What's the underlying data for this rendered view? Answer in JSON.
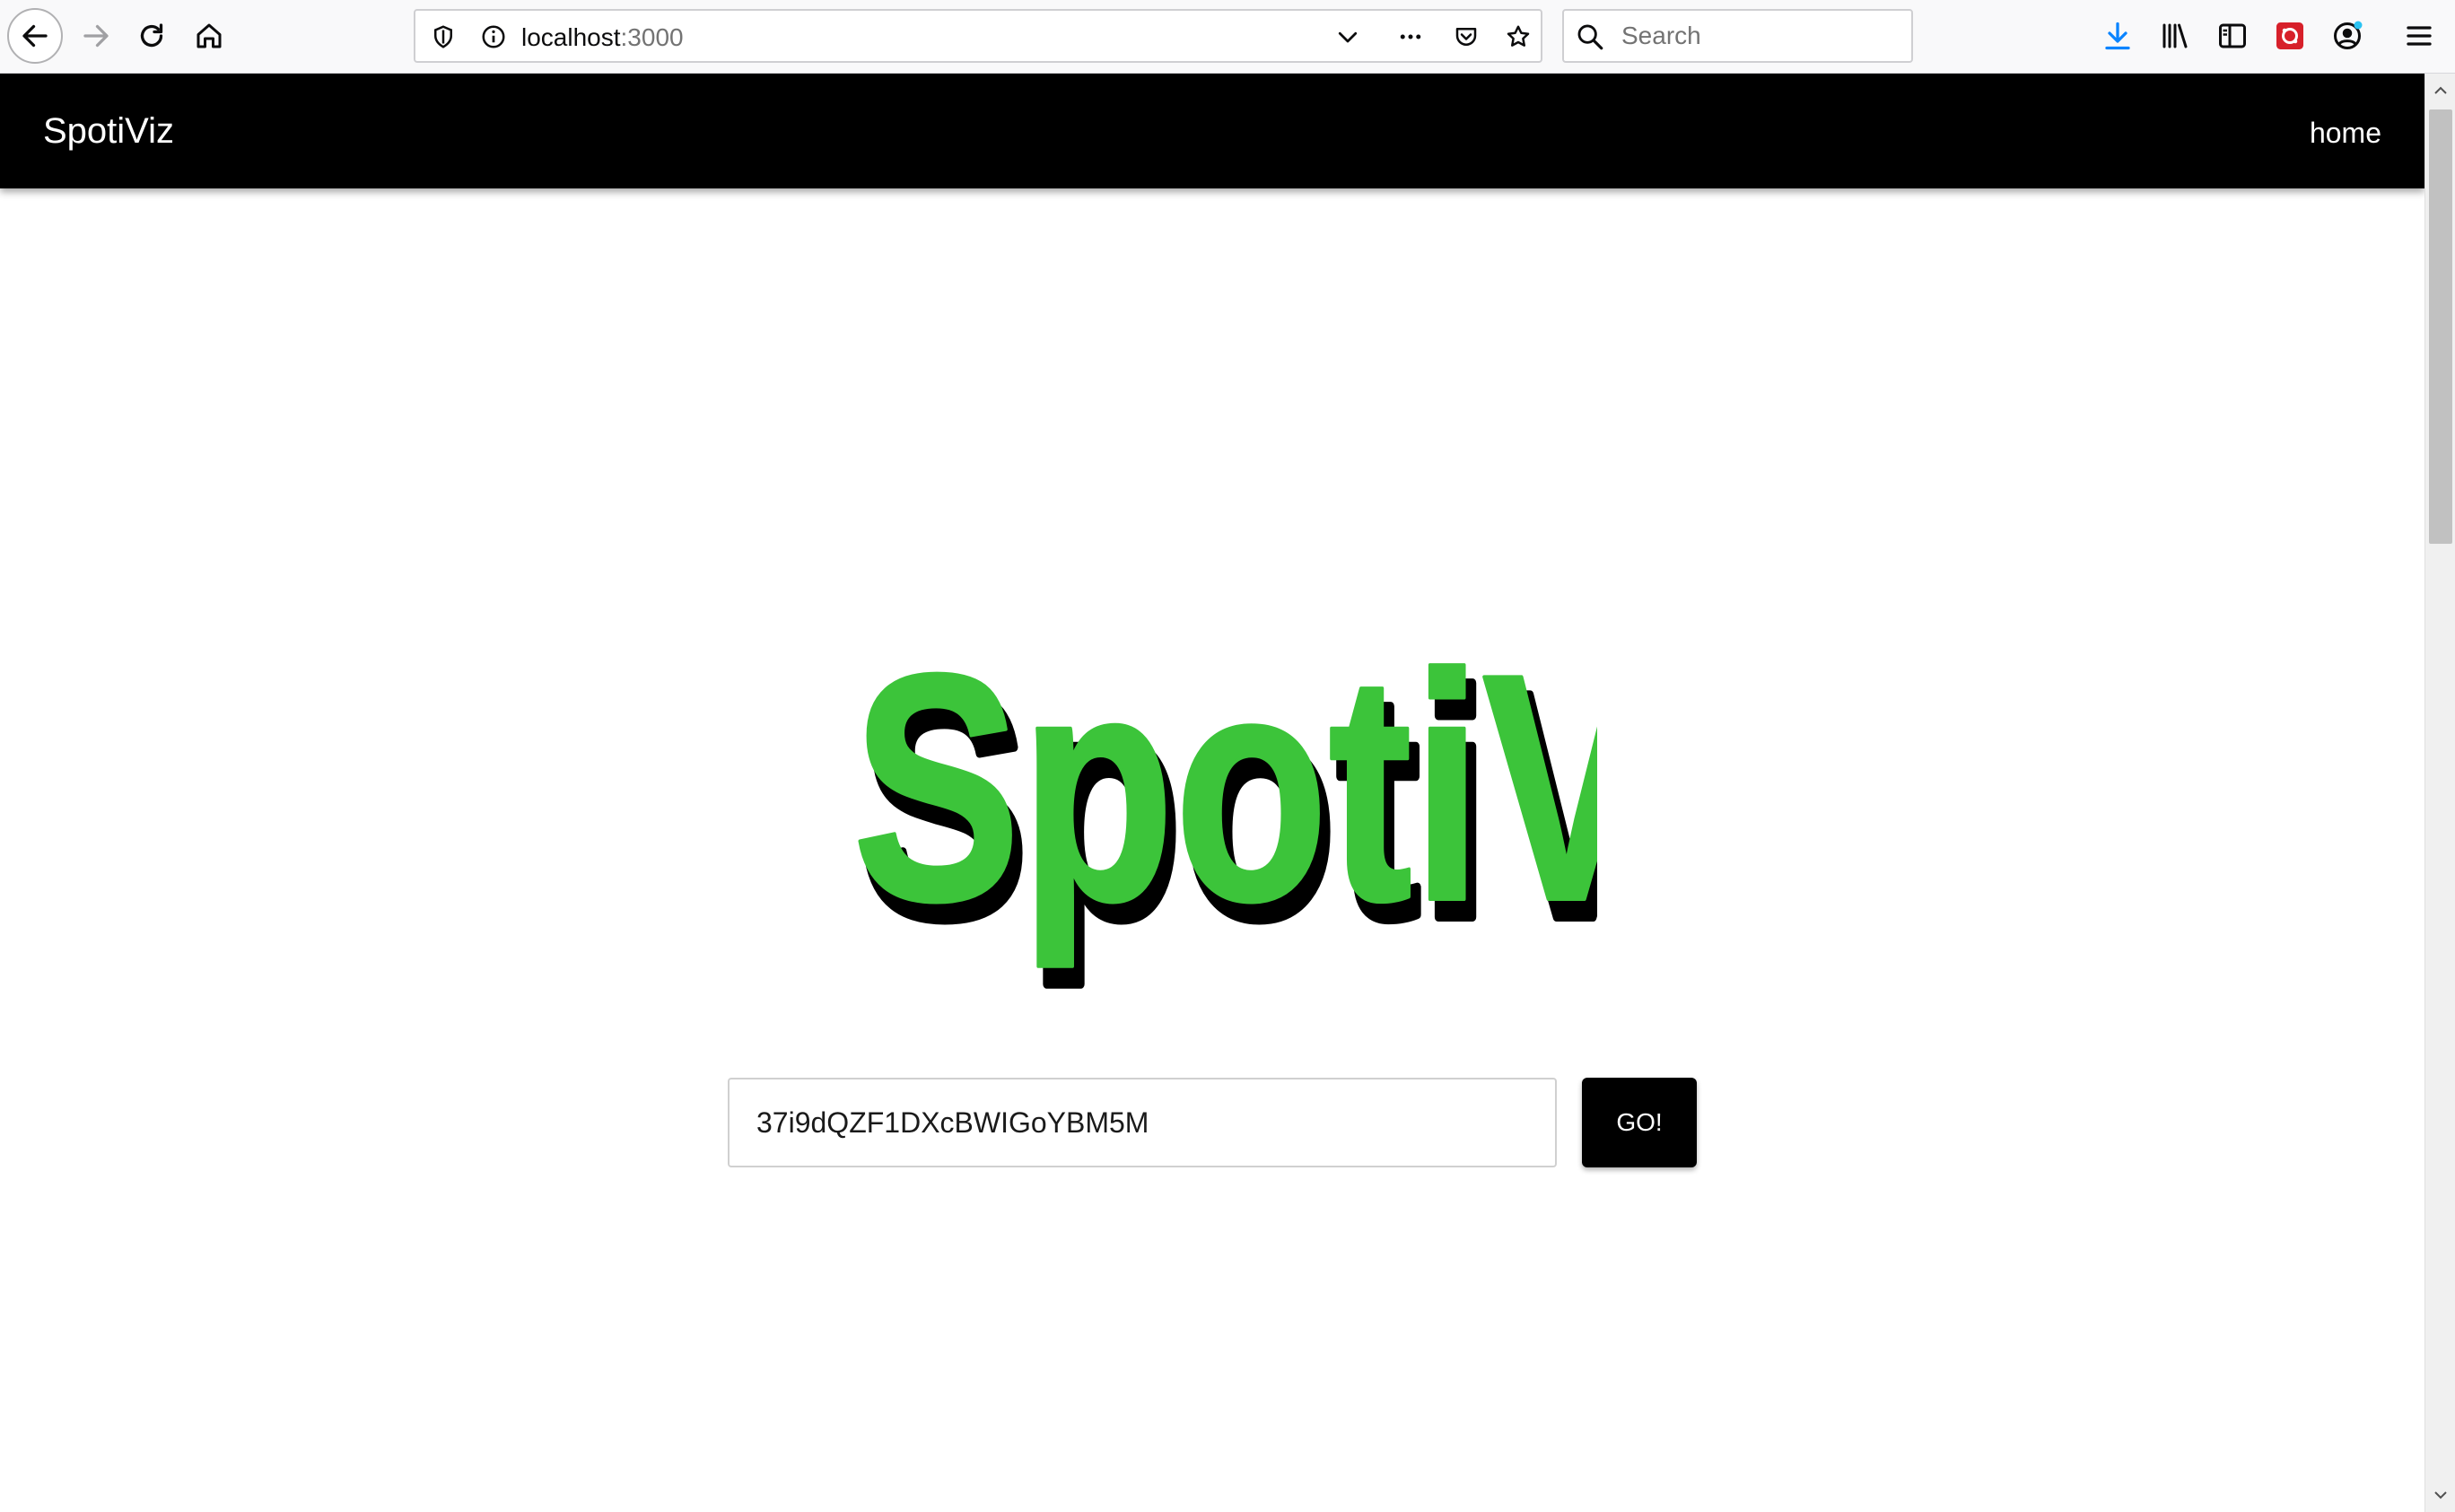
{
  "browser": {
    "url_host": "localhost",
    "url_port": ":3000",
    "search_placeholder": "Search"
  },
  "app": {
    "brand": "SpotiViz",
    "nav_home": "home",
    "logo_text": "SpotiViz",
    "input_value": "37i9dQZF1DXcBWIGoYBM5M",
    "go_label": "GO!",
    "colors": {
      "logo_green": "#3cc43a",
      "logo_shadow": "#000000",
      "navbar": "#000000",
      "button": "#000000"
    }
  }
}
